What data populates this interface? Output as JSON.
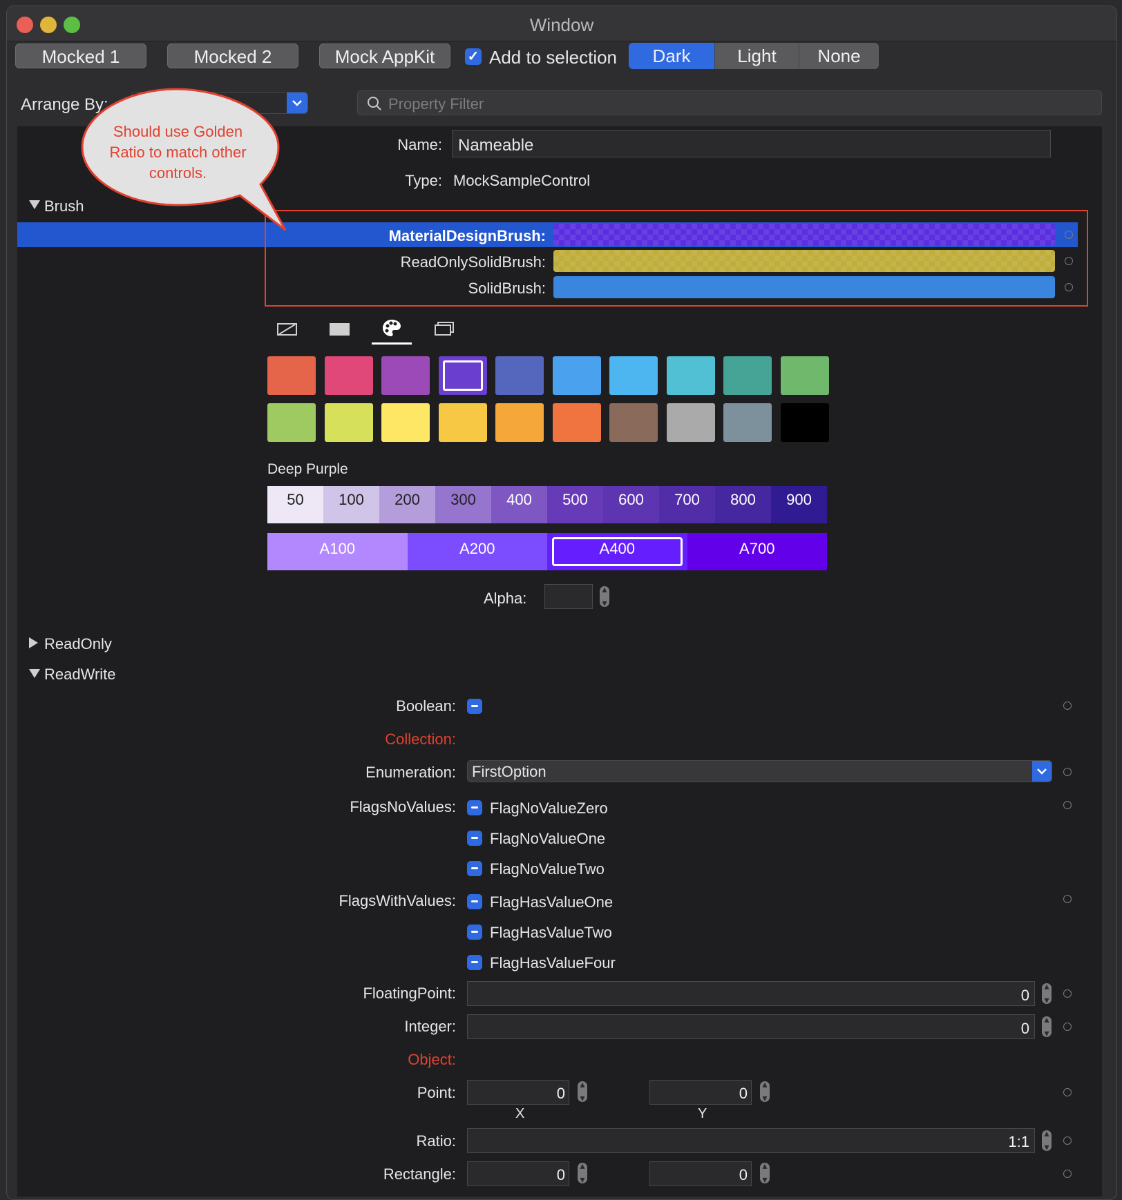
{
  "window": {
    "title": "Window"
  },
  "toolbar": {
    "mocked1": "Mocked 1",
    "mocked2": "Mocked 2",
    "mock_appkit": "Mock AppKit",
    "add_to_selection": "Add to selection",
    "add_to_selection_checked": true,
    "theme_segments": [
      "Dark",
      "Light",
      "None"
    ],
    "theme_selected": "Dark"
  },
  "arrange": {
    "label": "Arrange By:",
    "value": ""
  },
  "search": {
    "placeholder": "Property Filter"
  },
  "callout": {
    "text": "Should use Golden Ratio to match other controls."
  },
  "header": {
    "name_label": "Name:",
    "name_value": "Nameable",
    "type_label": "Type:",
    "type_value": "MockSampleControl"
  },
  "groups": {
    "brush": "Brush",
    "readonly": "ReadOnly",
    "readwrite": "ReadWrite"
  },
  "brush": {
    "material_label": "MaterialDesignBrush:",
    "readonly_label": "ReadOnlySolidBrush:",
    "solid_label": "SolidBrush:",
    "colors": {
      "material": "#5a2fe0",
      "readonly": "#bfae3c",
      "solid": "#3a86de"
    }
  },
  "palette": {
    "icons": [
      "no-brush-icon",
      "solid-brush-icon",
      "palette-icon",
      "resource-icon"
    ],
    "selected_tab": "palette-icon",
    "swatches_row1": [
      "#e5654a",
      "#e0487a",
      "#9c4ab8",
      "#6a3fcf",
      "#5567bd",
      "#4aa1ee",
      "#4db5ef",
      "#51c0d4",
      "#45a496",
      "#6fb86c"
    ],
    "swatches_row2": [
      "#9fca62",
      "#d7e05a",
      "#fde764",
      "#f7c843",
      "#f5a73a",
      "#ef7440",
      "#8a6b5b",
      "#aaaaaa",
      "#7c919c",
      "#000000"
    ],
    "selected_swatch": 3,
    "name": "Deep Purple",
    "shades": [
      "50",
      "100",
      "200",
      "300",
      "400",
      "500",
      "600",
      "700",
      "800",
      "900"
    ],
    "shade_colors": [
      "#ede7f6",
      "#d1c4e9",
      "#b39ddb",
      "#9575cd",
      "#7e57c2",
      "#673ab7",
      "#5e35b1",
      "#512da8",
      "#4527a0",
      "#311b92"
    ],
    "accents": [
      "A100",
      "A200",
      "A400",
      "A700"
    ],
    "accent_colors": [
      "#b388ff",
      "#7c4dff",
      "#651fff",
      "#6200ea"
    ],
    "selected_accent": "A400",
    "alpha_label": "Alpha:",
    "alpha_value": ""
  },
  "readwrite": {
    "boolean_label": "Boolean:",
    "collection_label": "Collection:",
    "enumeration_label": "Enumeration:",
    "enumeration_value": "FirstOption",
    "flags_novalues_label": "FlagsNoValues:",
    "flags_novalues": [
      "FlagNoValueZero",
      "FlagNoValueOne",
      "FlagNoValueTwo"
    ],
    "flags_withvalues_label": "FlagsWithValues:",
    "flags_withvalues": [
      "FlagHasValueOne",
      "FlagHasValueTwo",
      "FlagHasValueFour"
    ],
    "floating_label": "FloatingPoint:",
    "floating_value": "0",
    "integer_label": "Integer:",
    "integer_value": "0",
    "object_label": "Object:",
    "point_label": "Point:",
    "point_x": "0",
    "point_y": "0",
    "point_x_caption": "X",
    "point_y_caption": "Y",
    "ratio_label": "Ratio:",
    "ratio_value": "1:1",
    "rectangle_label": "Rectangle:",
    "rect_a": "0",
    "rect_b": "0"
  }
}
